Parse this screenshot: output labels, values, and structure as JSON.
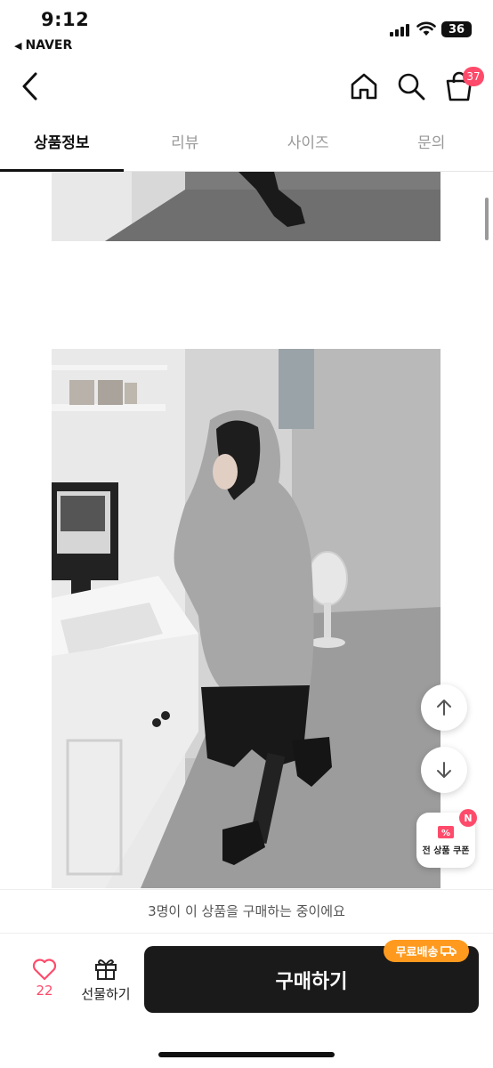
{
  "status_bar": {
    "time": "9:12",
    "back_app": "NAVER",
    "battery": "36"
  },
  "header": {
    "back_icon": "chevron-left-icon",
    "home_icon": "home-icon",
    "search_icon": "search-icon",
    "cart_icon": "shopping-bag-icon",
    "cart_count": "37"
  },
  "tabs": [
    {
      "label": "상품정보",
      "active": true
    },
    {
      "label": "리뷰",
      "active": false
    },
    {
      "label": "사이즈",
      "active": false
    },
    {
      "label": "문의",
      "active": false
    }
  ],
  "floating": {
    "scroll_up_icon": "arrow-up-icon",
    "scroll_down_icon": "arrow-down-icon",
    "coupon_label": "전 상품 쿠폰",
    "coupon_badge": "N"
  },
  "bottom": {
    "buyers_notice": "3명이 이 상품을 구매하는 중이에요",
    "like_count": "22",
    "gift_label": "선물하기",
    "buy_label": "구매하기",
    "free_shipping": "무료배송"
  },
  "colors": {
    "accent": "#ff4b6b",
    "shipping": "#ff9a1e",
    "buy": "#1a1a1a"
  }
}
